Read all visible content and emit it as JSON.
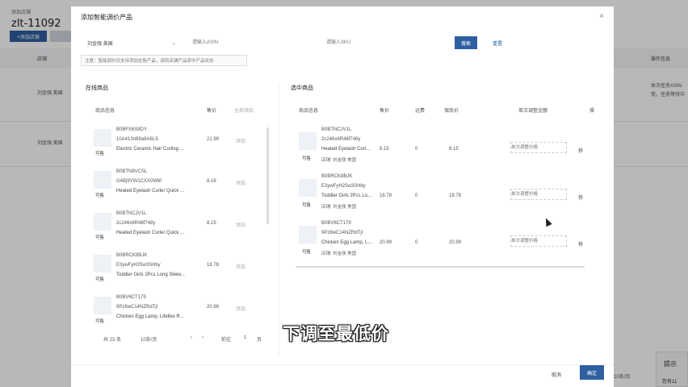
{
  "background": {
    "top_small_text": "添加店铺",
    "watermark": "zlt-11092",
    "action_button": "+添加店铺",
    "header_store": "店铺",
    "header_op": "操作信息",
    "row1_store": "刘金强 美国",
    "row2_store": "刘金强 美国",
    "op_info": "本次任务ASIN常，任务等待中",
    "tip_title": "提示",
    "tip_text": "您有11",
    "pager_text": "10条/页"
  },
  "modal": {
    "title": "添加智能调价产品",
    "close": "×",
    "store_select": "刘金强 美国",
    "asin_placeholder": "请输入ASIN",
    "sku_placeholder": "请输入SKU",
    "search_label": "搜索",
    "reset_label": "重置",
    "note": "注意：智能调价仅支持添加在售产品，请到店铺产品库中产品状态"
  },
  "left": {
    "section_title": "在线商品",
    "headers": {
      "info": "商品信息",
      "price": "售价",
      "add_all": "全部添加"
    },
    "rows": [
      {
        "asin": "B0BFX6S8DY",
        "sku": "10A413n89a9A6LS",
        "title": "Electric Ceramic Hair Curling ...",
        "price": "21.99",
        "add": "添加",
        "avail": "可售"
      },
      {
        "asin": "B0BTN8VCSL",
        "sku": "G4Bj9YW1CXX0W6f",
        "title": "Heated Eyelash Curler Quick ...",
        "price": "8.16",
        "add": "添加",
        "avail": "可售"
      },
      {
        "asin": "B0BTNCJV1L",
        "sku": "2c246x6R48f748y",
        "title": "Heated Eyelash Curler Quick ...",
        "price": "8.15",
        "add": "添加",
        "avail": "可售"
      },
      {
        "asin": "B0BRCK8BJK",
        "sku": "E3ywFyH25w3SHby",
        "title": "Toddler Girls 2Pcs Long Sleev...",
        "price": "18.78",
        "add": "添加",
        "avail": "可售"
      },
      {
        "asin": "B0BV6CT179",
        "sku": "9Pz8wC14NZRdTjl",
        "title": "Chicken Egg Lamp, Lifelike R...",
        "price": "20.99",
        "add": "添加",
        "avail": "可售"
      }
    ],
    "pager": {
      "total": "共 23 条",
      "size": "10条/页",
      "prev": "‹",
      "next": "›",
      "goto": "前往",
      "page": "1",
      "unit": "页"
    }
  },
  "right": {
    "section_title": "选中商品",
    "headers": {
      "info": "商品信息",
      "price": "售价",
      "ship": "运费",
      "guar": "保底价",
      "adj": "单次调整金额",
      "op": "操"
    },
    "rows": [
      {
        "asin": "B0BTNCJV1L",
        "sku": "2c246x6R48f748y",
        "title": "Heated Eyelash Curl...",
        "store": "店铺: 刘金强 美国",
        "price": "8.15",
        "ship": "0",
        "guar": "8.15",
        "adj": "单次调整价格",
        "del": "移",
        "avail": "可售"
      },
      {
        "asin": "B0BRCK8BJK",
        "sku": "E3ywFyH25w3SHby",
        "title": "Toddler Girls 2Pcs Lo...",
        "store": "店铺: 刘金强 美国",
        "price": "18.78",
        "ship": "0",
        "guar": "18.78",
        "adj": "单次调整价格",
        "del": "移",
        "avail": "可售"
      },
      {
        "asin": "B0BV6CT179",
        "sku": "9Pz8wC14NZRdTjl",
        "title": "Chicken Egg Lamp, L...",
        "store": "店铺: 刘金强 美国",
        "price": "20.99",
        "ship": "0",
        "guar": "20.99",
        "adj": "单次调整价格",
        "del": "移",
        "avail": "可售"
      }
    ]
  },
  "footer": {
    "cancel": "取消",
    "ok": "确定"
  },
  "subtitle": "下调至最低价"
}
